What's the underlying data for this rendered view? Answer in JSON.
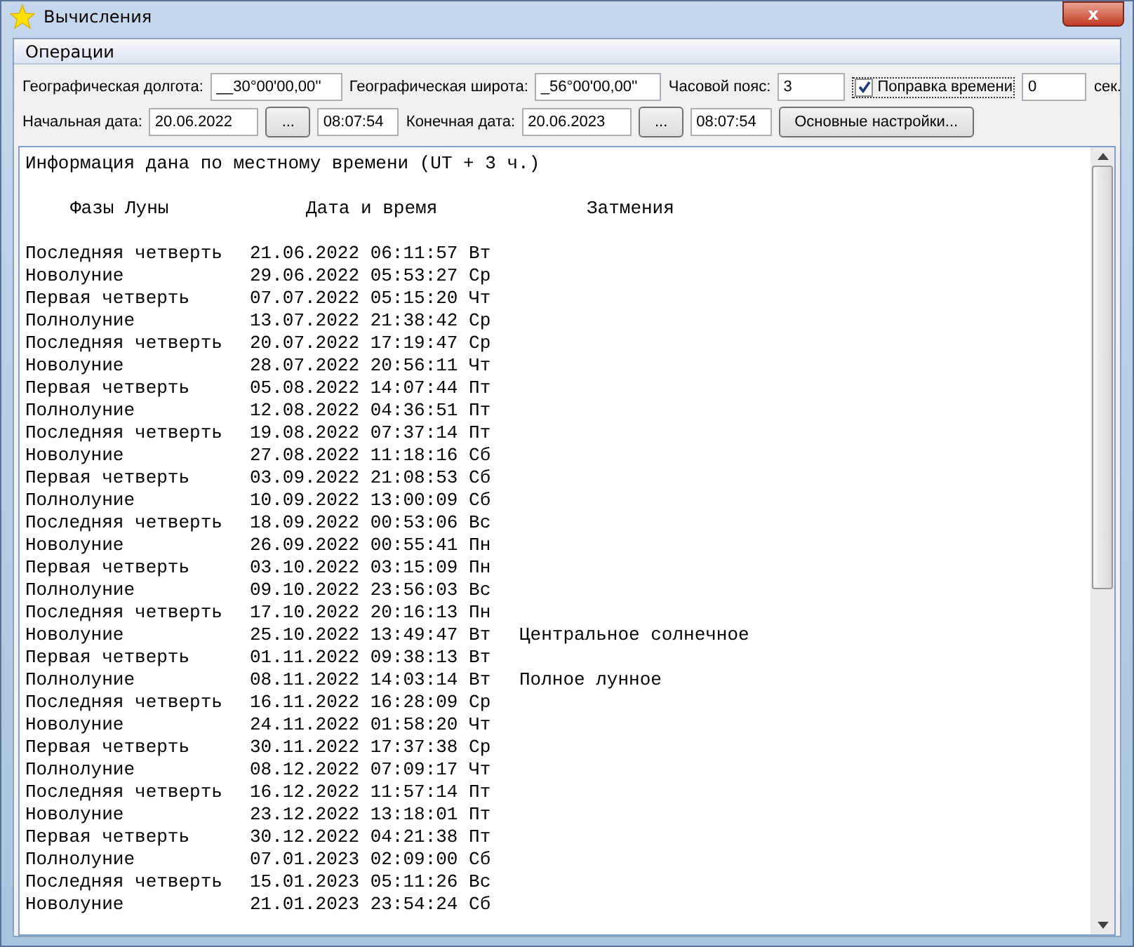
{
  "window": {
    "title": "Вычисления",
    "close_label": "x"
  },
  "menu": [
    {
      "label": "Операции"
    }
  ],
  "params": {
    "longitude_label": "Географическая долгота:",
    "longitude": "__30°00'00,00''",
    "latitude_label": "Географическая широта:",
    "latitude": "_56°00'00,00''",
    "timezone_label": "Часовой пояс:",
    "timezone": "3",
    "correction_label": "Поправка времени",
    "correction_checked": true,
    "correction": "0",
    "seconds_label": "сек.",
    "start_label": "Начальная дата:",
    "start_date": "20.06.2022",
    "start_button": "...",
    "start_time": "08:07:54",
    "end_label": "Конечная дата:",
    "end_date": "20.06.2023",
    "end_button": "...",
    "end_time": "08:07:54",
    "settings_button": "Основные настройки..."
  },
  "output": {
    "info": "Информация дана по местному времени (UT + 3 ч.)",
    "headers": [
      "Фазы Луны",
      "Дата и время",
      "Затмения"
    ],
    "rows": [
      {
        "phase": "Последняя четверть",
        "datetime": "21.06.2022 06:11:57 Вт"
      },
      {
        "phase": "Новолуние",
        "datetime": "29.06.2022 05:53:27 Ср"
      },
      {
        "phase": "Первая четверть",
        "datetime": "07.07.2022 05:15:20 Чт"
      },
      {
        "phase": "Полнолуние",
        "datetime": "13.07.2022 21:38:42 Ср"
      },
      {
        "phase": "Последняя четверть",
        "datetime": "20.07.2022 17:19:47 Ср"
      },
      {
        "phase": "Новолуние",
        "datetime": "28.07.2022 20:56:11 Чт"
      },
      {
        "phase": "Первая четверть",
        "datetime": "05.08.2022 14:07:44 Пт"
      },
      {
        "phase": "Полнолуние",
        "datetime": "12.08.2022 04:36:51 Пт"
      },
      {
        "phase": "Последняя четверть",
        "datetime": "19.08.2022 07:37:14 Пт"
      },
      {
        "phase": "Новолуние",
        "datetime": "27.08.2022 11:18:16 Сб"
      },
      {
        "phase": "Первая четверть",
        "datetime": "03.09.2022 21:08:53 Сб"
      },
      {
        "phase": "Полнолуние",
        "datetime": "10.09.2022 13:00:09 Сб"
      },
      {
        "phase": "Последняя четверть",
        "datetime": "18.09.2022 00:53:06 Вс"
      },
      {
        "phase": "Новолуние",
        "datetime": "26.09.2022 00:55:41 Пн"
      },
      {
        "phase": "Первая четверть",
        "datetime": "03.10.2022 03:15:09 Пн"
      },
      {
        "phase": "Полнолуние",
        "datetime": "09.10.2022 23:56:03 Вс"
      },
      {
        "phase": "Последняя четверть",
        "datetime": "17.10.2022 20:16:13 Пн"
      },
      {
        "phase": "Новолуние",
        "datetime": "25.10.2022 13:49:47 Вт",
        "eclipse": "Центральное солнечное"
      },
      {
        "phase": "Первая четверть",
        "datetime": "01.11.2022 09:38:13 Вт"
      },
      {
        "phase": "Полнолуние",
        "datetime": "08.11.2022 14:03:14 Вт",
        "eclipse": "Полное лунное"
      },
      {
        "phase": "Последняя четверть",
        "datetime": "16.11.2022 16:28:09 Ср"
      },
      {
        "phase": "Новолуние",
        "datetime": "24.11.2022 01:58:20 Чт"
      },
      {
        "phase": "Первая четверть",
        "datetime": "30.11.2022 17:37:38 Ср"
      },
      {
        "phase": "Полнолуние",
        "datetime": "08.12.2022 07:09:17 Чт"
      },
      {
        "phase": "Последняя четверть",
        "datetime": "16.12.2022 11:57:14 Пт"
      },
      {
        "phase": "Новолуние",
        "datetime": "23.12.2022 13:18:01 Пт"
      },
      {
        "phase": "Первая четверть",
        "datetime": "30.12.2022 04:21:38 Пт"
      },
      {
        "phase": "Полнолуние",
        "datetime": "07.01.2023 02:09:00 Сб"
      },
      {
        "phase": "Последняя четверть",
        "datetime": "15.01.2023 05:11:26 Вс"
      },
      {
        "phase": "Новолуние",
        "datetime": "21.01.2023 23:54:24 Сб"
      }
    ]
  }
}
